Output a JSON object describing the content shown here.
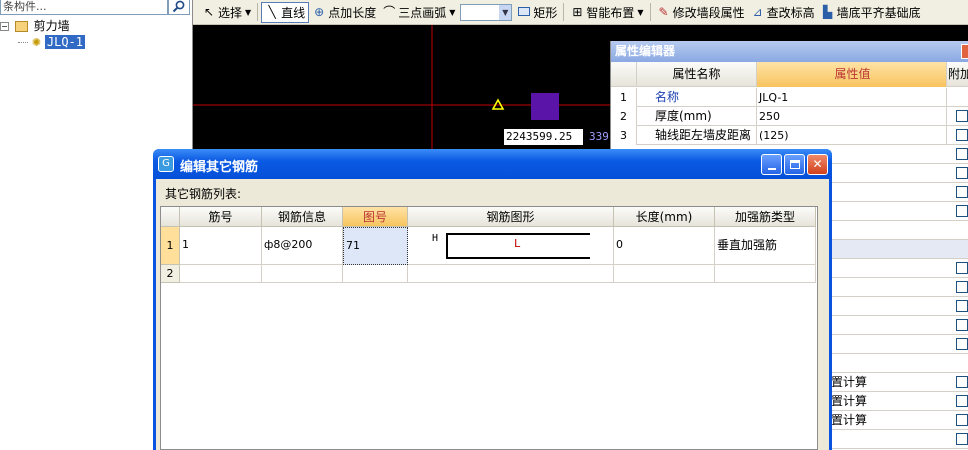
{
  "tree": {
    "search_placeholder": "条构件...",
    "root_label": "剪力墙",
    "child_label": "JLQ-1"
  },
  "toolbar": {
    "select_label": "选择",
    "line_label": "直线",
    "point_length_label": "点加长度",
    "arc_label": "三点画弧",
    "rect_label": "矩形",
    "smart_layout_label": "智能布置",
    "modify_wall_label": "修改墙段属性",
    "check_elev_label": "查改标高",
    "align_label": "墙底平齐基础底"
  },
  "canvas": {
    "coord_x": "2243599.25",
    "coord_y": "339"
  },
  "property_editor": {
    "title": "属性编辑器",
    "col_name": "属性名称",
    "col_value": "属性值",
    "col_extra": "附加",
    "rows": [
      {
        "num": "1",
        "name": "名称",
        "value": "JLQ-1"
      },
      {
        "num": "2",
        "name": "厚度(mm)",
        "value": "250"
      },
      {
        "num": "3",
        "name": "轴线距左墙皮距离",
        "value": "(125)"
      }
    ],
    "side_texts": [
      "置计算",
      "置计算",
      "置计算"
    ]
  },
  "dialog": {
    "title": "编辑其它钢筋",
    "list_label": "其它钢筋列表:",
    "columns": [
      "筋号",
      "钢筋信息",
      "图号",
      "钢筋图形",
      "长度(mm)",
      "加强筋类型"
    ],
    "rows": [
      {
        "num": "1",
        "bar_no": "1",
        "info": "ф8@200",
        "fig_no": "71",
        "shape_h": "H",
        "shape_l": "L",
        "length": "0",
        "type": "垂直加强筋"
      },
      {
        "num": "2",
        "bar_no": "",
        "info": "",
        "fig_no": "",
        "shape_h": "",
        "shape_l": "",
        "length": "",
        "type": ""
      }
    ]
  },
  "colors": {
    "accent_blue": "#0a53e0",
    "selection": "#316ac5",
    "header_highlight": "#f7c45e",
    "canvas_bg": "#000000",
    "axis_red": "#c00000",
    "purple_block": "#5a14a8"
  }
}
